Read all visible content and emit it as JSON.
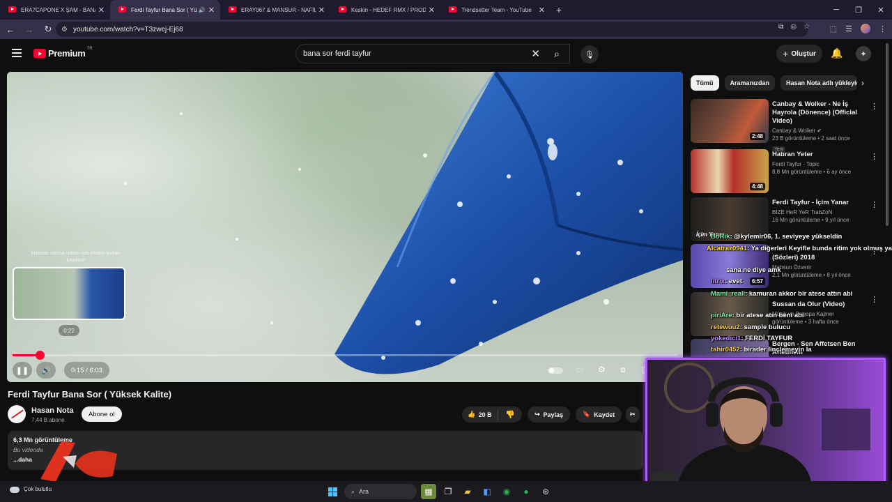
{
  "browser": {
    "tabs": [
      {
        "title": "ERA7CAPONE X ŞAM - BANA S",
        "active": false
      },
      {
        "title": "Ferdi Tayfur Bana Sor ( Yüks",
        "active": true,
        "audio": true
      },
      {
        "title": "ERAY067 & MANSUR - NAFİLE",
        "active": false
      },
      {
        "title": "Keskin - HEDEF RMX / PROD. E",
        "active": false
      },
      {
        "title": "Trendsetter Team - YouTube",
        "active": false
      }
    ],
    "url": "youtube.com/watch?v=T3zwej-Ej68"
  },
  "masthead": {
    "logo_text": "Premium",
    "country_code": "TR",
    "search_value": "bana sor ferdi tayfur",
    "create_label": "Oluştur"
  },
  "player": {
    "hint_text": "Hassas sarma işlemi için ekranı yukarı kaydırın",
    "preview_time": "0:22",
    "current_time": "0:15",
    "duration": "6:03",
    "time_display": "0:15 / 6:03",
    "progress_fraction": 0.0413
  },
  "video": {
    "title": "Ferdi Tayfur Bana Sor ( Yüksek Kalite)",
    "channel": "Hasan Nota",
    "subscribers": "7,44 B abone",
    "subscribe_label": "Abone ol",
    "likes": "20 B",
    "share_label": "Paylaş",
    "save_label": "Kaydet",
    "views": "6,3 Mn görüntüleme",
    "desc_line": "Bu videoda",
    "more_label": "...daha"
  },
  "sidebar": {
    "chips": [
      "Tümü",
      "Aramanızdan",
      "Hasan Nota adlı yükleyic"
    ],
    "items": [
      {
        "title": "Canbay & Wolker - Ne İş Hayrola (Dönence) (Official Video)",
        "channel": "Canbay & Wolker",
        "verified": true,
        "meta": "23 B görüntüleme • 2 saat önce",
        "badge": "Yeni",
        "duration": "2:48"
      },
      {
        "title": "Hatıran Yeter",
        "channel": "Ferdi Tayfur - Topic",
        "meta": "8,8 Mn görüntüleme • 6 ay önce",
        "duration": "4:48"
      },
      {
        "title": "Ferdi Tayfur - İçim Yanar",
        "channel": "BİZE HeR YeR TrabZoN",
        "meta": "16 Mn görüntüleme • 9 yıl önce",
        "thumb_text": "İçim Yanar"
      },
      {
        "title": "(Sözleri) 2018",
        "channel": "Mahsun Özverir",
        "meta": "2,1 Mn görüntüleme • 8 yıl önce",
        "duration": "6:57"
      },
      {
        "title": "Sussan da Olur (Video)",
        "channel": "Müzik ve Sagopa Kajmer",
        "meta": "görüntüleme • 3 hafta önce"
      },
      {
        "title": "Bergen - Sen Affetsen Ben Affetmem"
      }
    ]
  },
  "chat": [
    {
      "user": "BoRik",
      "text": ": @kylemir06, 1. seviyeye yükseldin"
    },
    {
      "user": "Alcatraz0941",
      "text": ": Ya diğerleri Keyifle bunda ritim yok olmuş ya"
    },
    {
      "user": "",
      "text": "sana ne diye amk"
    },
    {
      "user": "litrix",
      "text": ": evet"
    },
    {
      "user": "Mami_reall",
      "text": ": kamuran akkor bir atese attın abi"
    },
    {
      "user": "piriAre",
      "text": ": bir atese atın beni abi"
    },
    {
      "user": "retewuu2",
      "text": ": sample bulucu"
    },
    {
      "user": "yokedici1",
      "text": ": FERDİ TAYFUR"
    },
    {
      "user": "tahir0452",
      "text": ": birader linçlemeyin la"
    }
  ],
  "taskbar": {
    "weather": "Çok bulutlu",
    "search_label": "Ara"
  },
  "colors": {
    "accent_red": "#ff0033",
    "cam_border": "#b05cff",
    "chrome_bg": "#35304a"
  }
}
